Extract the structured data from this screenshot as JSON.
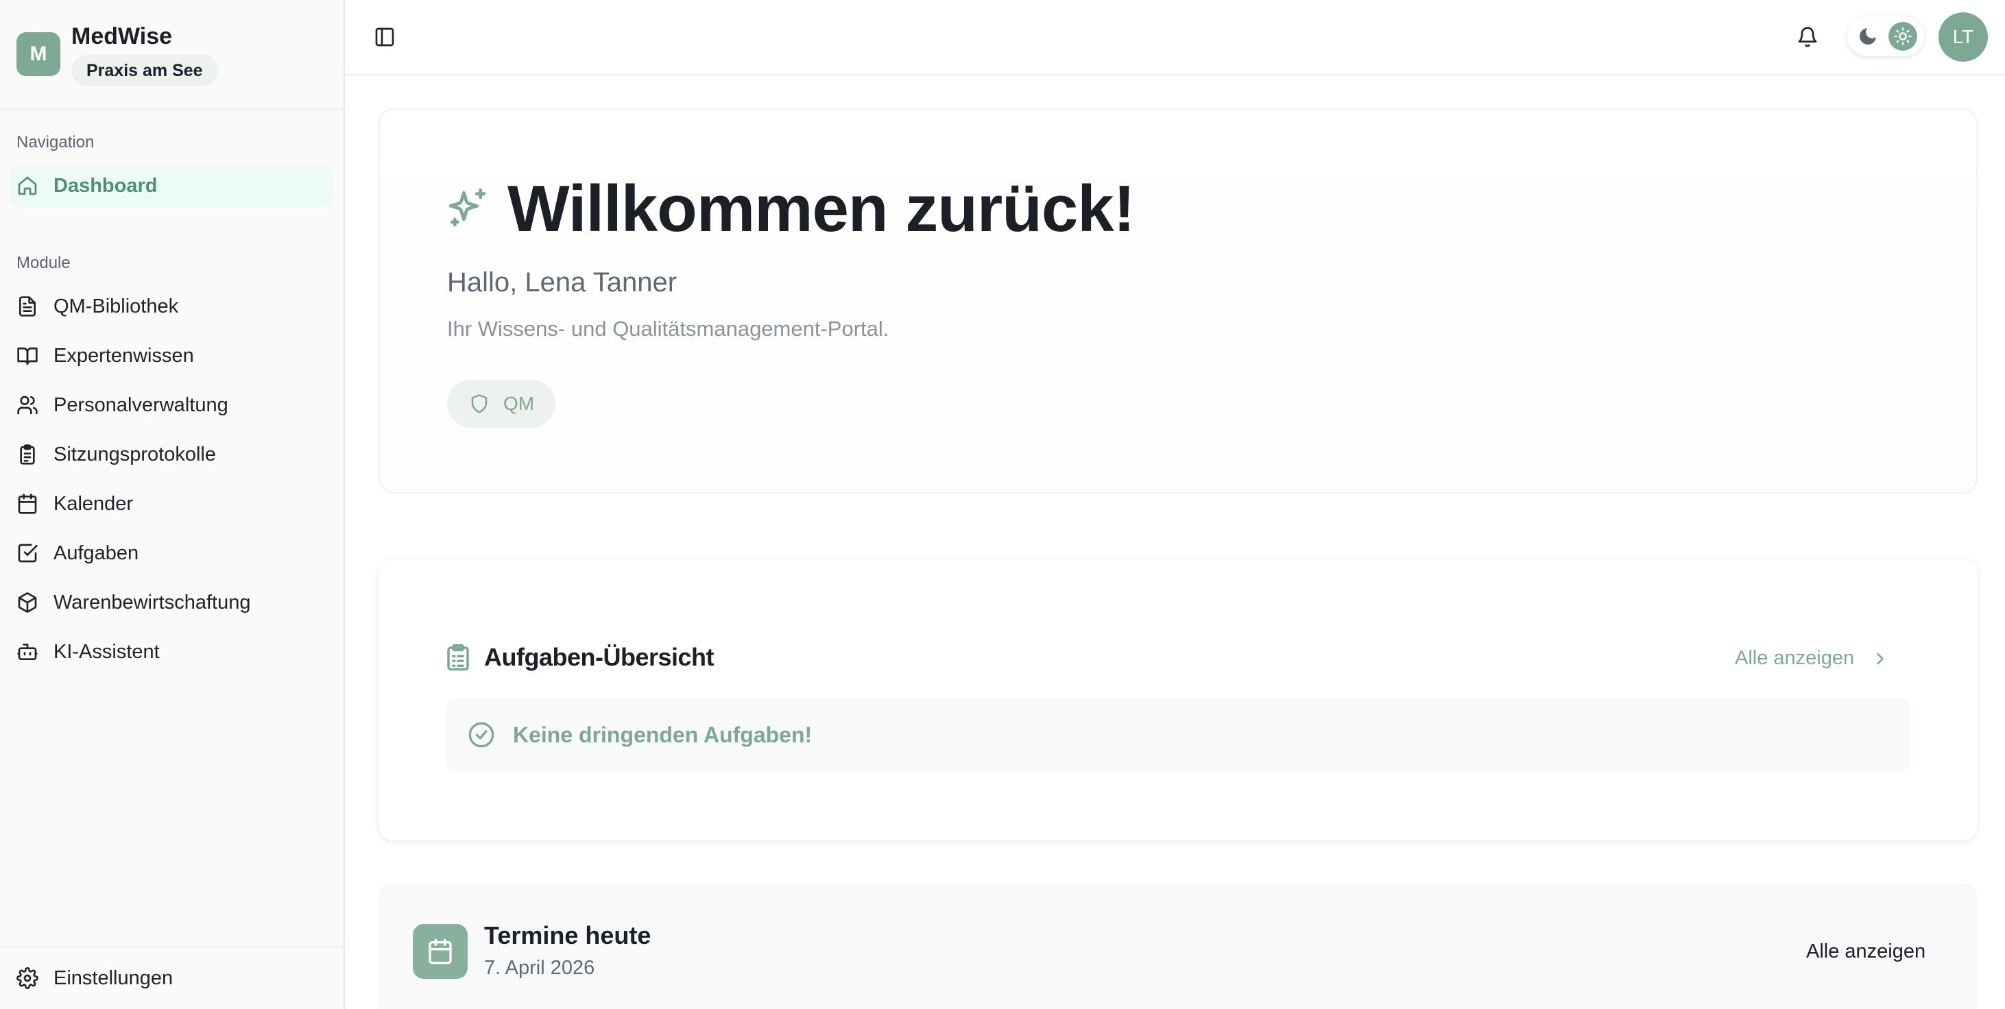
{
  "app": {
    "name": "MedWise",
    "logo_letter": "M",
    "practice": "Praxis am See"
  },
  "sidebar": {
    "navigation_label": "Navigation",
    "dashboard": "Dashboard",
    "module_label": "Module",
    "modules": [
      {
        "label": "QM-Bibliothek",
        "icon": "file-text-icon"
      },
      {
        "label": "Expertenwissen",
        "icon": "book-open-icon"
      },
      {
        "label": "Personalverwaltung",
        "icon": "users-icon"
      },
      {
        "label": "Sitzungsprotokolle",
        "icon": "clipboard-list-icon"
      },
      {
        "label": "Kalender",
        "icon": "calendar-icon"
      },
      {
        "label": "Aufgaben",
        "icon": "check-square-icon"
      },
      {
        "label": "Warenbewirtschaftung",
        "icon": "package-icon"
      },
      {
        "label": "KI-Assistent",
        "icon": "bot-icon"
      }
    ],
    "settings": "Einstellungen"
  },
  "topbar": {
    "user_initials": "LT"
  },
  "welcome": {
    "title": "Willkommen zurück!",
    "greeting": "Hallo, Lena Tanner",
    "subtitle": "Ihr Wissens- und Qualitätsmanagement-Portal.",
    "badge": "QM"
  },
  "tasks": {
    "title": "Aufgaben-Übersicht",
    "link": "Alle anzeigen",
    "empty": "Keine dringenden Aufgaben!"
  },
  "appointments": {
    "title": "Termine heute",
    "date": "7. April 2026",
    "link": "Alle anzeigen"
  },
  "colors": {
    "accent": "#7ea896",
    "active_bg": "#ecfbf6",
    "active_text": "#4e8f78"
  }
}
